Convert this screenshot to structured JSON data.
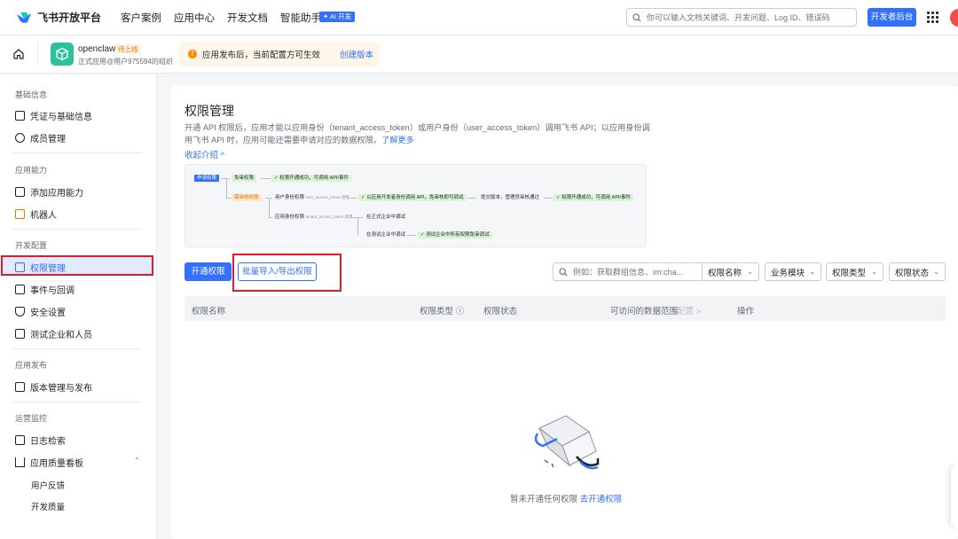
{
  "topnav": {
    "brand": "飞书开放平台",
    "items": [
      "客户案例",
      "应用中心",
      "开发文档",
      "智能助手"
    ],
    "ai_badge": "✦ AI 开发",
    "search_placeholder": "你可以输入文档关键词、开发问题、Log ID、错误码",
    "dev_console": "开发者后台"
  },
  "appbar": {
    "app_name": "openclaw",
    "app_status": "待上线",
    "app_owner": "正式应用@用户975594的组织",
    "notice": "应用发布后，当前配置方可生效",
    "notice_link": "创建版本"
  },
  "sidebar": {
    "groups": [
      {
        "title": "基础信息",
        "items": [
          "凭证与基础信息",
          "成员管理"
        ]
      },
      {
        "title": "应用能力",
        "items": [
          "添加应用能力",
          "机器人"
        ]
      },
      {
        "title": "开发配置",
        "items": [
          "权限管理",
          "事件与回调",
          "安全设置",
          "测试企业和人员"
        ]
      },
      {
        "title": "应用发布",
        "items": [
          "版本管理与发布"
        ]
      },
      {
        "title": "运营监控",
        "items": [
          "日志检索",
          "应用质量看板"
        ],
        "subitems": [
          "用户反馈",
          "开发质量"
        ]
      }
    ],
    "active": "权限管理"
  },
  "main": {
    "title": "权限管理",
    "desc": "开通 API 权限后，应用才能以应用身份（tenant_access_token）或用户身份（user_access_token）调用飞书 API；以应用身份调用飞书 API 时，应用可能还需要申请对应的数据权限。",
    "learn_more": "了解更多",
    "collapse": "收起介绍 ^",
    "flow": {
      "apply": "申请权限",
      "free": "免审权限",
      "free_result": "✓ 权限开通成功，可调用 API/事件",
      "review": "需审核权限",
      "user_identity": "用户身份权限",
      "user_token": "user_access_token 调用",
      "user_step": "✓ 以应用开发者身份调用 API，免审核即可调试",
      "publish": "提交版本，管理员审核通过",
      "publish_result": "✓ 权限开通成功，可调用 API/事件",
      "app_identity": "应用身份权限",
      "tenant_token": "tenant_access_token 调用",
      "prod_debug": "在正式企业中调试",
      "test_debug": "在测试企业中调试",
      "test_step": "✓ 测试企业中所有权限免审调试"
    },
    "btn_open": "开通权限",
    "btn_batch": "批量导入/导出权限",
    "search_placeholder": "例如：获取群组信息、im:cha...",
    "filters": [
      "权限名称",
      "业务模块",
      "权限类型",
      "权限状态"
    ],
    "columns": [
      "权限名称",
      "权限类型 ⓘ",
      "权限状态",
      "可访问的数据范围",
      "配置 >",
      "操作"
    ],
    "empty_text": "暂未开通任何权限",
    "empty_link": "去开通权限"
  }
}
